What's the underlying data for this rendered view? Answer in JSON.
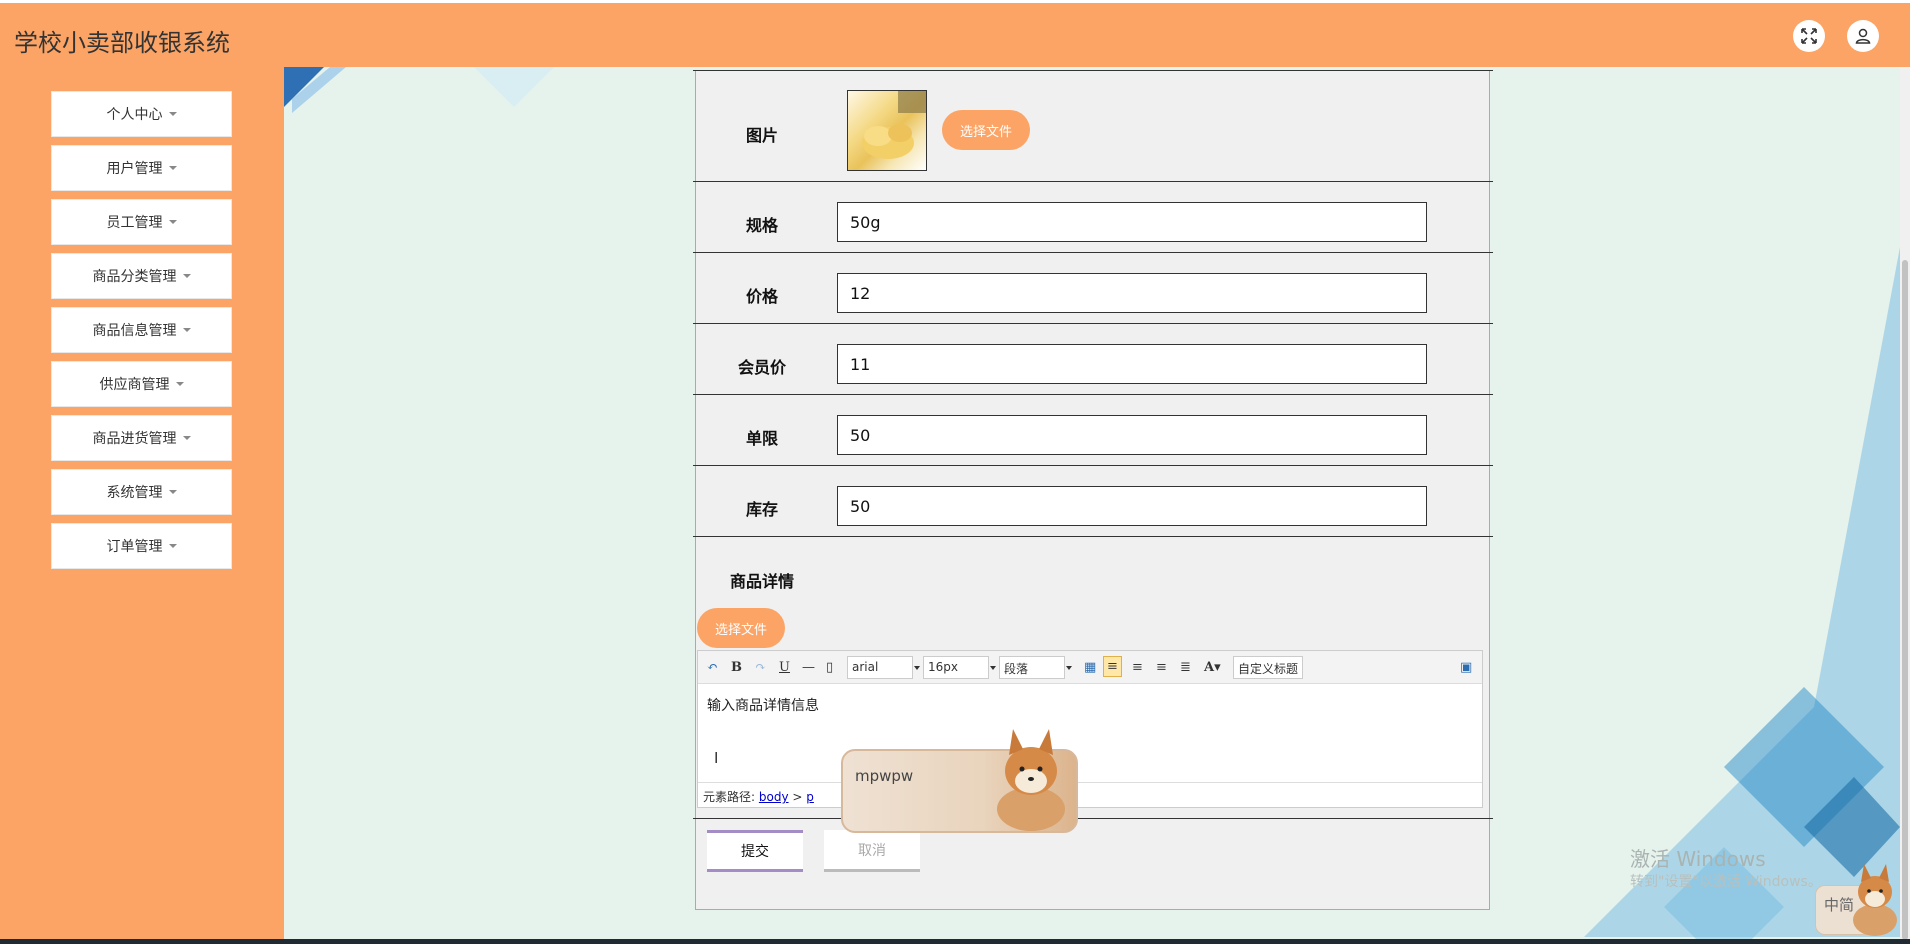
{
  "header": {
    "title": "学校小卖部收银系统",
    "fullscreen_icon": "expand-icon",
    "user_icon": "user-icon"
  },
  "sidebar": {
    "items": [
      {
        "label": "个人中心"
      },
      {
        "label": "用户管理"
      },
      {
        "label": "员工管理"
      },
      {
        "label": "商品分类管理"
      },
      {
        "label": "商品信息管理"
      },
      {
        "label": "供应商管理"
      },
      {
        "label": "商品进货管理"
      },
      {
        "label": "系统管理"
      },
      {
        "label": "订单管理"
      }
    ]
  },
  "form": {
    "image_label": "图片",
    "choose_file": "选择文件",
    "spec_label": "规格",
    "spec_value": "50g",
    "price_label": "价格",
    "price_value": "12",
    "member_price_label": "会员价",
    "member_price_value": "11",
    "limit_label": "单限",
    "limit_value": "50",
    "stock_label": "库存",
    "stock_value": "50",
    "detail_label": "商品详情",
    "detail_choose_file": "选择文件",
    "submit": "提交",
    "cancel": "取消"
  },
  "editor": {
    "font_family": "arial",
    "font_size": "16px",
    "paragraph": "段落",
    "custom_title": "自定义标题",
    "body_text": "输入商品详情信息",
    "path_label": "元素路径:",
    "path_body": "body",
    "path_sep": ">",
    "path_p": "p"
  },
  "ime": {
    "composition": "mpwpw",
    "mode": "中简"
  },
  "watermark": {
    "line1": "激活 Windows",
    "line2": "转到\"设置\"以激活 Windows。"
  },
  "colors": {
    "accent": "#fba466",
    "background": "#e6f2ec",
    "panel": "#f0f0f0"
  }
}
